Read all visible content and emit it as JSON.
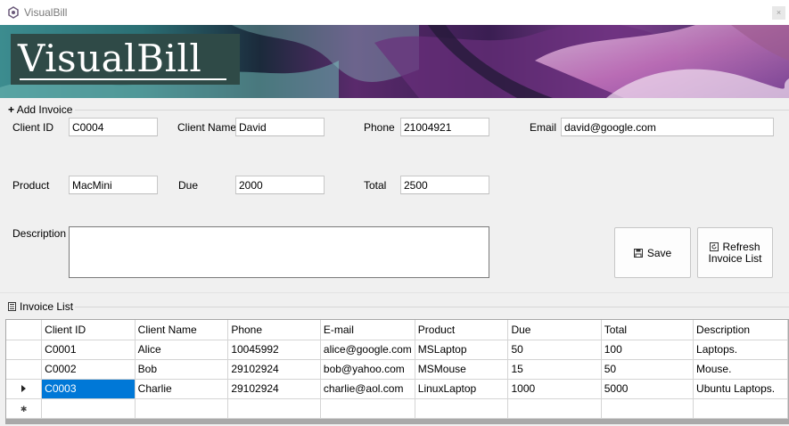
{
  "window": {
    "title": "VisualBill",
    "icon": "app-icon",
    "close_glyph": "×"
  },
  "banner": {
    "logo_text": "VisualBill"
  },
  "add_invoice": {
    "group_label": "Add Invoice",
    "group_icon": "plus-icon",
    "fields": {
      "client_id": {
        "label": "Client ID",
        "value": "C0004"
      },
      "client_name": {
        "label": "Client Name",
        "value": "David"
      },
      "phone": {
        "label": "Phone",
        "value": "21004921"
      },
      "email": {
        "label": "Email",
        "value": "david@google.com"
      },
      "product": {
        "label": "Product",
        "value": "MacMini"
      },
      "due": {
        "label": "Due",
        "value": "2000"
      },
      "total": {
        "label": "Total",
        "value": "2500"
      },
      "description": {
        "label": "Description",
        "value": ""
      }
    },
    "save_button": {
      "label": "Save",
      "icon": "save-icon"
    },
    "refresh_button": {
      "line1": "Refresh",
      "line2": "Invoice List",
      "icon": "refresh-icon"
    }
  },
  "invoice_list": {
    "group_label": "Invoice List",
    "group_icon": "list-icon",
    "columns": [
      "Client ID",
      "Client Name",
      "Phone",
      "E-mail",
      "Product",
      "Due",
      "Total",
      "Description"
    ],
    "rows": [
      [
        "C0001",
        "Alice",
        "10045992",
        "alice@google.com",
        "MSLaptop",
        "50",
        "100",
        "Laptops."
      ],
      [
        "C0002",
        "Bob",
        "29102924",
        "bob@yahoo.com",
        "MSMouse",
        "15",
        "50",
        "Mouse."
      ],
      [
        "C0003",
        "Charlie",
        "29102924",
        "charlie@aol.com",
        "LinuxLaptop",
        "1000",
        "5000",
        "Ubuntu Laptops."
      ]
    ],
    "current_row_index": 2,
    "new_row_glyph": "✱"
  },
  "colors": {
    "selection": "#0078d7",
    "panel_bg": "#f0f0f0",
    "logo_bg": "#2f4a47"
  }
}
